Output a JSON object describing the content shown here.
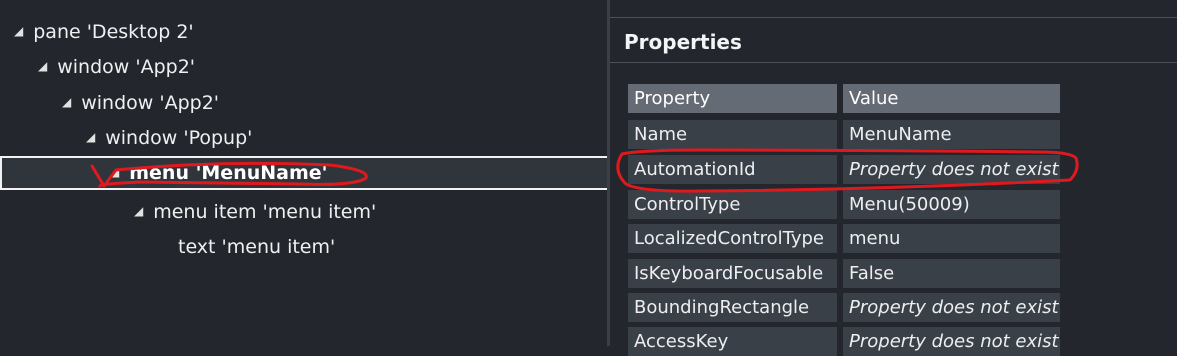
{
  "tree": {
    "nodes": [
      {
        "label": "pane 'Desktop 2'",
        "indent": 0,
        "expanded": true
      },
      {
        "label": "window 'App2'",
        "indent": 1,
        "expanded": true
      },
      {
        "label": "window 'App2'",
        "indent": 2,
        "expanded": true
      },
      {
        "label": "window 'Popup'",
        "indent": 3,
        "expanded": true
      },
      {
        "label": "menu 'MenuName'",
        "indent": 4,
        "expanded": true,
        "selected": true
      },
      {
        "label": "menu item 'menu item'",
        "indent": 5,
        "expanded": true
      },
      {
        "label": "text 'menu item'",
        "indent": 6,
        "expanded": false
      }
    ],
    "selected_row_actions": {
      "more": "···",
      "test_icon": "beaker-icon"
    }
  },
  "properties": {
    "title": "Properties",
    "columns": [
      "Property",
      "Value"
    ],
    "rows": [
      {
        "property": "Name",
        "value": "MenuName",
        "missing": false
      },
      {
        "property": "AutomationId",
        "value": "Property does not exist",
        "missing": true
      },
      {
        "property": "ControlType",
        "value": "Menu(50009)",
        "missing": false
      },
      {
        "property": "LocalizedControlType",
        "value": "menu",
        "missing": false
      },
      {
        "property": "IsKeyboardFocusable",
        "value": "False",
        "missing": false
      },
      {
        "property": "BoundingRectangle",
        "value": "Property does not exist",
        "missing": true
      },
      {
        "property": "AccessKey",
        "value": "Property does not exist",
        "missing": true
      }
    ]
  },
  "colors": {
    "background": "#23272d",
    "cell": "#3a4048",
    "header_cell": "#646b74",
    "annotation": "#e0191e"
  }
}
